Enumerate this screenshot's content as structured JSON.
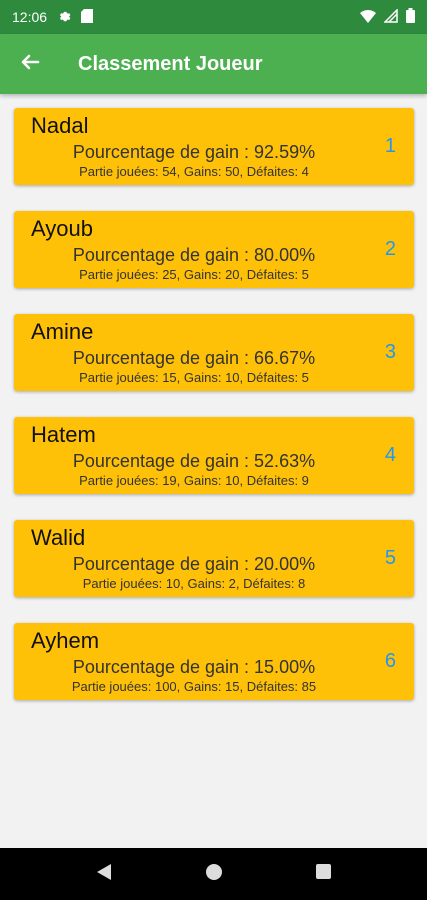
{
  "status_bar": {
    "time": "12:06",
    "icons_left": [
      "settings-icon",
      "sim-card-icon"
    ],
    "icons_right": [
      "wifi-icon",
      "signal-icon",
      "battery-icon"
    ]
  },
  "app_bar": {
    "title": "Classement Joueur",
    "back_icon": "arrow-left-icon",
    "color": "#4caf50"
  },
  "players": [
    {
      "name": "Nadal",
      "percentage": "Pourcentage de gain : 92.59%",
      "stats": "Partie jouées: 54, Gains: 50, Défaites: 4",
      "rank": "1"
    },
    {
      "name": "Ayoub",
      "percentage": "Pourcentage de gain : 80.00%",
      "stats": "Partie jouées: 25, Gains: 20, Défaites: 5",
      "rank": "2"
    },
    {
      "name": "Amine",
      "percentage": "Pourcentage de gain : 66.67%",
      "stats": "Partie jouées: 15, Gains: 10, Défaites: 5",
      "rank": "3"
    },
    {
      "name": "Hatem",
      "percentage": "Pourcentage de gain : 52.63%",
      "stats": "Partie jouées: 19, Gains: 10, Défaites: 9",
      "rank": "4"
    },
    {
      "name": "Walid",
      "percentage": "Pourcentage de gain : 20.00%",
      "stats": "Partie jouées: 10, Gains: 2, Défaites: 8",
      "rank": "5"
    },
    {
      "name": "Ayhem",
      "percentage": "Pourcentage de gain : 15.00%",
      "stats": "Partie jouées: 100, Gains: 15, Défaites: 85",
      "rank": "6"
    }
  ],
  "card_color": "#ffc107",
  "rank_color": "#2196f3",
  "nav_bar": {
    "icons": [
      "back-triangle-icon",
      "home-circle-icon",
      "recents-square-icon"
    ]
  }
}
